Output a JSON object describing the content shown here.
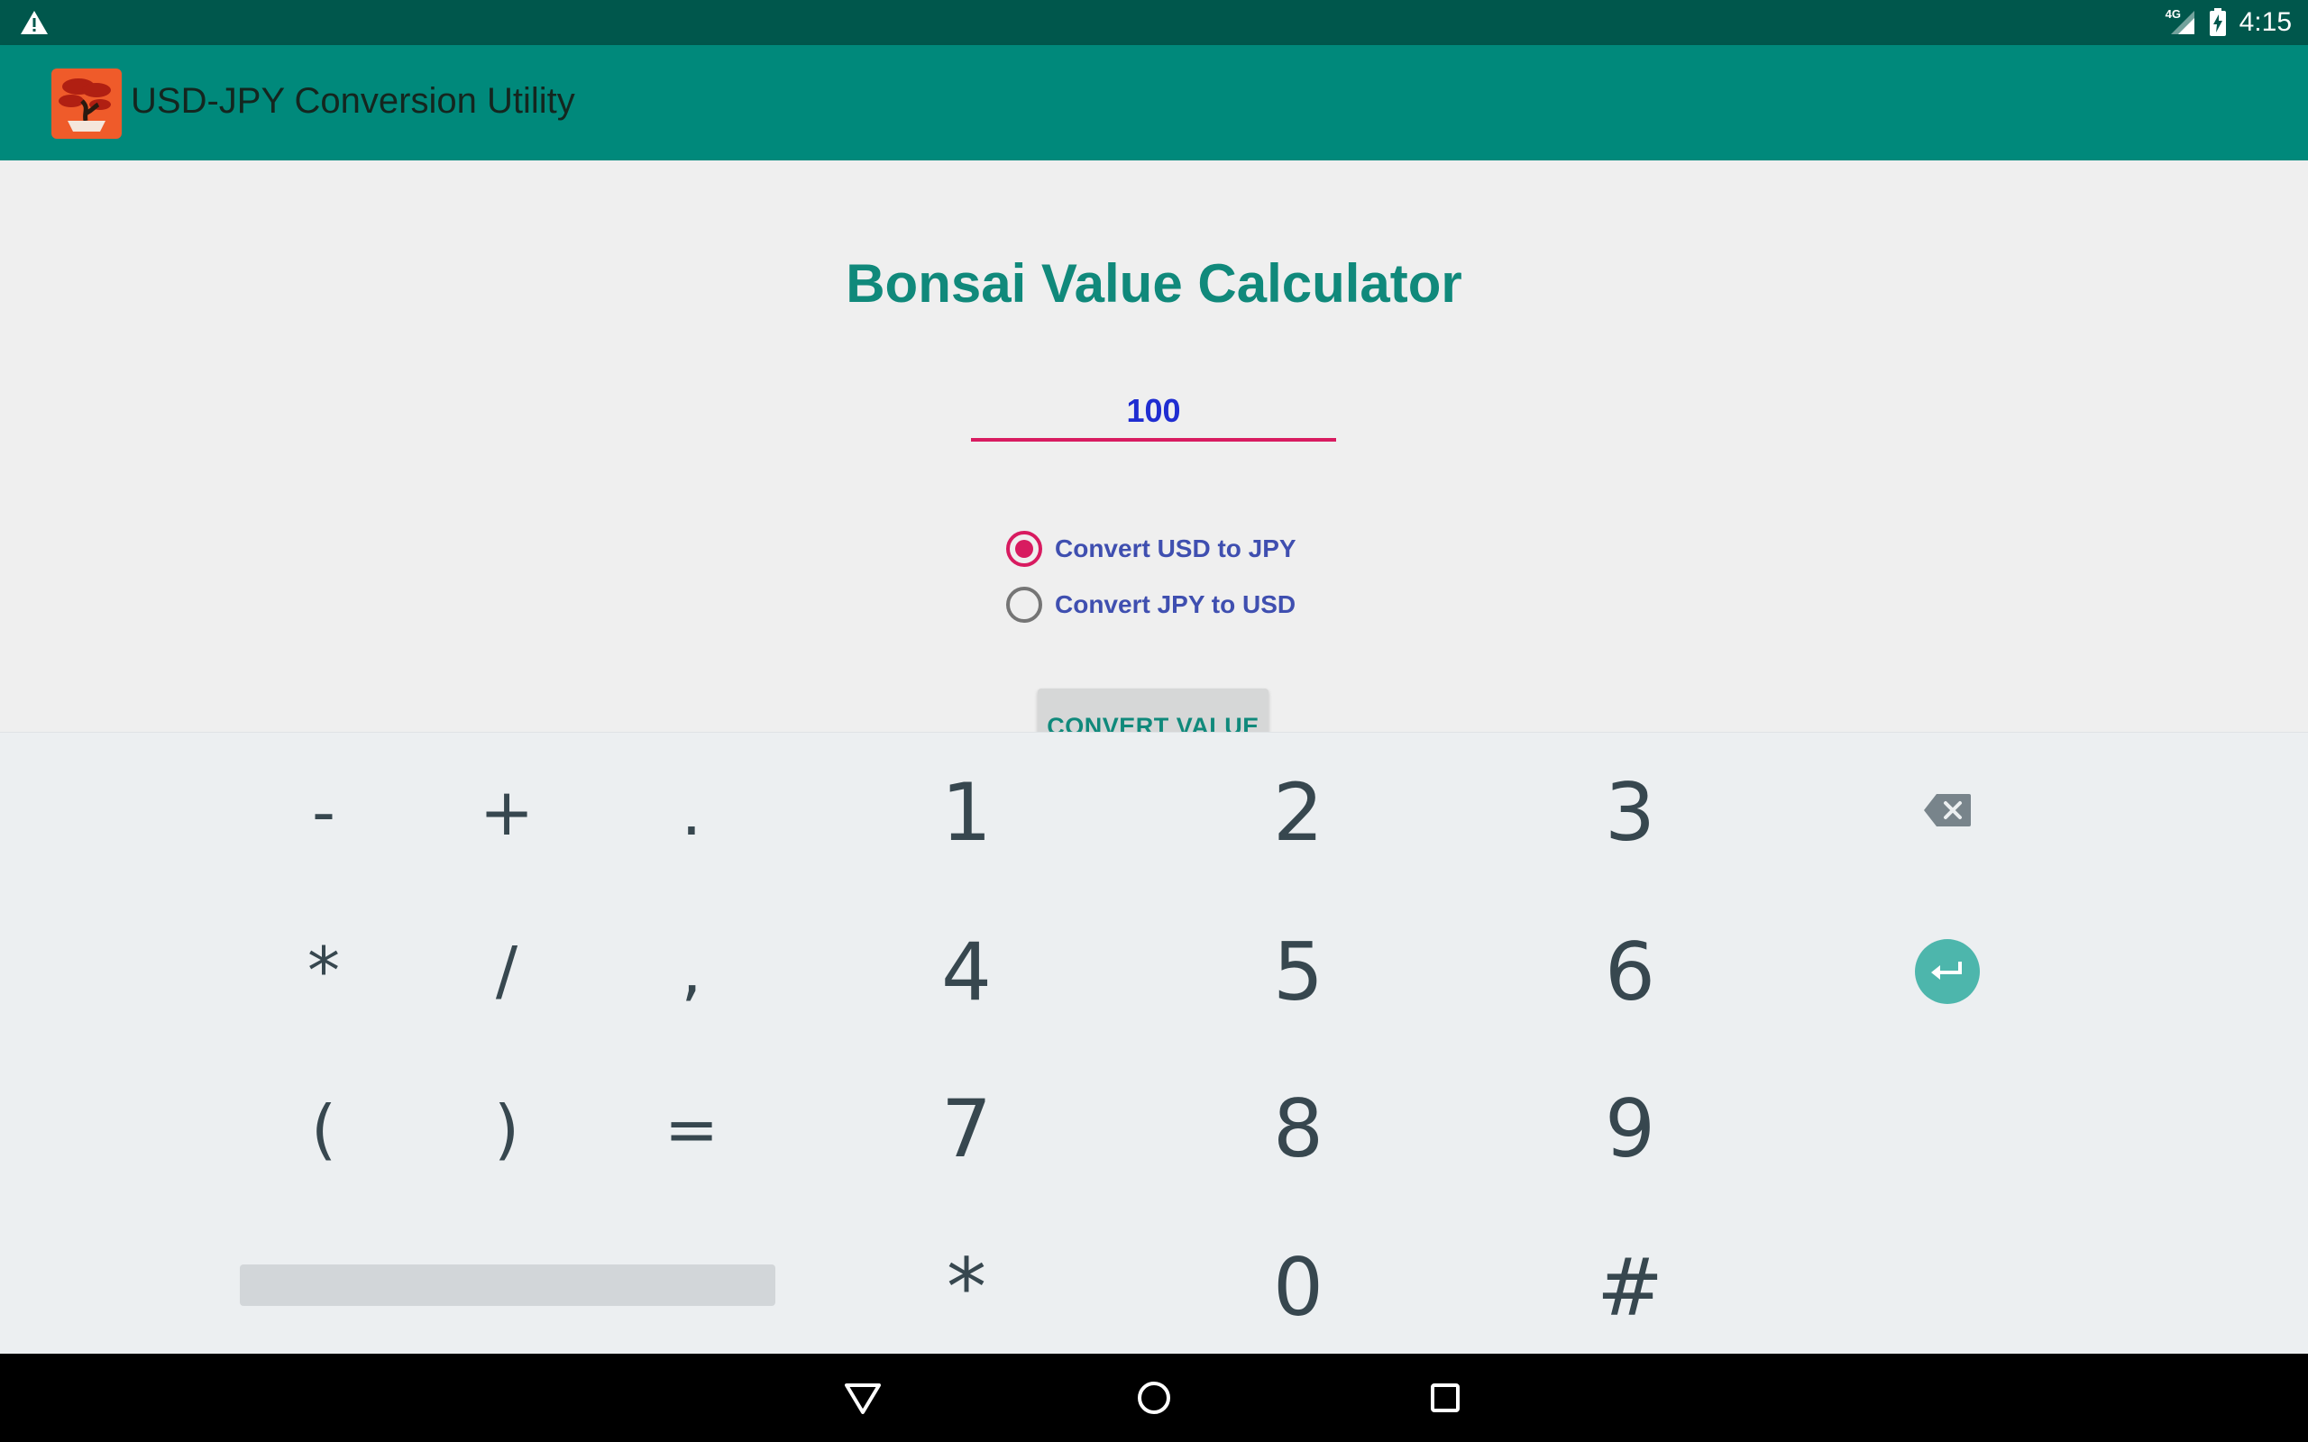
{
  "status_bar": {
    "time": "4:15",
    "network": "4G",
    "icons": [
      "warning-icon",
      "signal-icon",
      "battery-charging-icon"
    ]
  },
  "app_bar": {
    "title": "USD-JPY Conversion Utility",
    "logo_icon": "bonsai-logo-icon"
  },
  "main": {
    "title": "Bonsai Value Calculator",
    "amount_value": "100",
    "options": [
      {
        "label": "Convert USD to JPY",
        "checked": true
      },
      {
        "label": "Convert JPY to USD",
        "checked": false
      }
    ],
    "convert_button_label": "CONVERT VALUE"
  },
  "keyboard": {
    "symbols_row1": [
      "-",
      "+",
      "."
    ],
    "symbols_row2": [
      "*",
      "/",
      ","
    ],
    "symbols_row3": [
      "(",
      ")",
      "="
    ],
    "digits_row1": [
      "1",
      "2",
      "3"
    ],
    "digits_row2": [
      "4",
      "5",
      "6"
    ],
    "digits_row3": [
      "7",
      "8",
      "9"
    ],
    "digits_row4": [
      "*",
      "0",
      "#"
    ],
    "special_keys": [
      "backspace-icon",
      "enter-icon",
      "space-bar"
    ]
  },
  "nav_bar": {
    "buttons": [
      "back-icon",
      "home-icon",
      "recents-icon"
    ]
  },
  "colors": {
    "status_bar": "#00574c",
    "app_bar": "#00897b",
    "accent": "#d81b60",
    "title": "#10897b",
    "radio_label": "#3f4fb0",
    "input_text": "#1f2dd1",
    "keyboard_bg": "#eceff1",
    "enter_key": "#4db6ac"
  }
}
